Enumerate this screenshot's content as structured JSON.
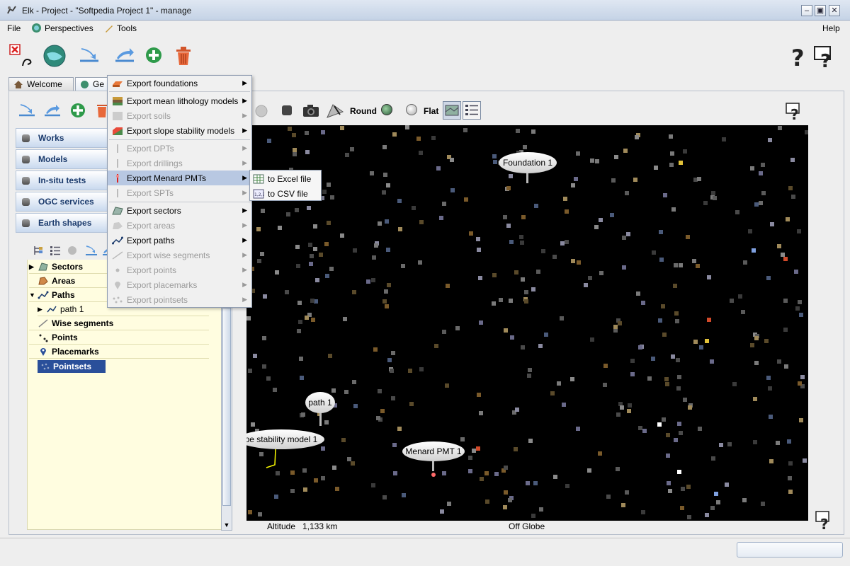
{
  "window": {
    "title": "Elk - Project - \"Softpedia Project 1\" - manage",
    "controls": [
      "minimize",
      "restore",
      "close"
    ]
  },
  "menubar": {
    "file": "File",
    "perspectives": "Perspectives",
    "tools": "Tools",
    "help": "Help"
  },
  "main_toolbar": {
    "buttons": [
      "disconnect-icon",
      "globe-icon",
      "import-icon",
      "export-icon",
      "add-icon",
      "delete-icon"
    ],
    "help_buttons": [
      "help-icon",
      "context-help-icon"
    ]
  },
  "tabs": {
    "welcome": "Welcome",
    "geo": "Ge"
  },
  "accordion": {
    "items": [
      "Works",
      "Models",
      "In-situ tests",
      "OGC services",
      "Earth shapes"
    ]
  },
  "tree": {
    "items": [
      {
        "label": "Sectors",
        "expanded": false
      },
      {
        "label": "Areas",
        "expanded": false
      },
      {
        "label": "Paths",
        "expanded": true
      },
      {
        "label": "path 1",
        "child": true
      },
      {
        "label": "Wise segments"
      },
      {
        "label": "Points"
      },
      {
        "label": "Placemarks"
      },
      {
        "label": "Pointsets",
        "selected": true
      }
    ]
  },
  "globe_toolbar": {
    "round": "Round",
    "flat": "Flat"
  },
  "globe": {
    "labels": {
      "foundation": "Foundation 1",
      "path": "path 1",
      "slope": "pe stability model 1",
      "menard": "Menard PMT 1"
    },
    "altitude_label": "Altitude",
    "altitude_value": "1,133 km",
    "globe_state": "Off Globe"
  },
  "export_menu": {
    "items": [
      {
        "label": "Export foundations",
        "enabled": true
      },
      {
        "label": "Export mean lithology models",
        "enabled": true
      },
      {
        "label": "Export soils",
        "enabled": false
      },
      {
        "label": "Export slope stability models",
        "enabled": true
      },
      {
        "label": "Export DPTs",
        "enabled": false
      },
      {
        "label": "Export drillings",
        "enabled": false
      },
      {
        "label": "Export Menard PMTs",
        "enabled": true,
        "active": true
      },
      {
        "label": "Export SPTs",
        "enabled": false
      },
      {
        "label": "Export sectors",
        "enabled": true
      },
      {
        "label": "Export areas",
        "enabled": false
      },
      {
        "label": "Export paths",
        "enabled": true
      },
      {
        "label": "Export wise segments",
        "enabled": false
      },
      {
        "label": "Export points",
        "enabled": false
      },
      {
        "label": "Export placemarks",
        "enabled": false
      },
      {
        "label": "Export pointsets",
        "enabled": false
      }
    ],
    "submenu": {
      "excel": "to Excel file",
      "csv": "to CSV file"
    }
  },
  "colors": {
    "accent": "#2a4f9a",
    "tree_bg": "#fffde0",
    "globe_bg": "#000000",
    "menu_hover": "#b8c8e2"
  }
}
